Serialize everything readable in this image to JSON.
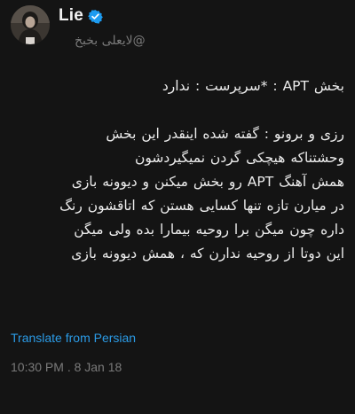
{
  "author": {
    "display_name": "Lie",
    "handle": "@لایعلی بخبخ",
    "avatar_icon": "avatar-photo",
    "verified_icon": "verified-badge-icon",
    "verified_color": "#1d9bf0"
  },
  "tweet": {
    "lines": [
      "بخش APT : *سرپرست : ندارد",
      "",
      "رزی و برونو : گفته شده اینقدر این بخش",
      "وحشتناکه هیچکی گردن نمیگیردشون",
      "همش آهنگ APT رو بخش میکنن و دیوونه بازی",
      "در میارن تازه تنها کسایی هستن که اتاقشون رنگ",
      "داره چون میگن برا روحیه بیمارا بده ولی میگن",
      "این دوتا از روحیه ندارن که ، همش دیوونه بازی"
    ],
    "translate_label": "Translate from Persian",
    "translate_color": "#2b9be6",
    "timestamp": "10:30 PM . 8 Jan 18"
  },
  "colors": {
    "background": "#141414",
    "text": "#ececec",
    "muted": "#7a7a7a"
  }
}
